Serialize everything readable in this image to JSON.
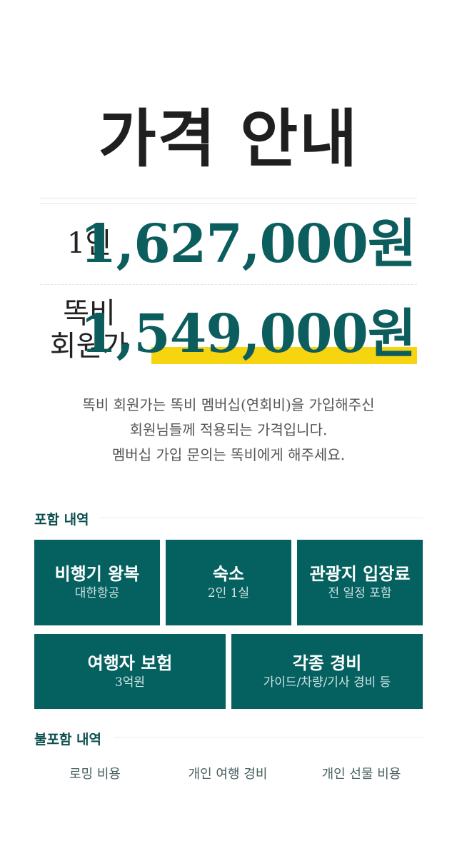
{
  "title": "가격 안내",
  "prices": [
    {
      "label_line1": "1인",
      "label_line2": "",
      "amount": "1,627,000원"
    },
    {
      "label_line1": "똑비",
      "label_line2": "회원가",
      "amount": "1,549,000원"
    }
  ],
  "note": [
    "똑비 회원가는 똑비 멤버십(연회비)을 가입해주신",
    "회원님들께 적용되는 가격입니다.",
    "멤버십 가입 문의는 똑비에게 해주세요."
  ],
  "included": {
    "heading": "포함 내역",
    "items": [
      {
        "title": "비행기 왕복",
        "sub": "대한항공"
      },
      {
        "title": "숙소",
        "sub": "2인 1실"
      },
      {
        "title": "관광지 입장료",
        "sub": "전 일정 포함"
      },
      {
        "title": "여행자 보험",
        "sub": "3억원"
      },
      {
        "title": "각종 경비",
        "sub": "가이드/차량/기사 경비 등"
      }
    ]
  },
  "excluded": {
    "heading": "불포함 내역",
    "items": [
      "로밍 비용",
      "개인 여행 경비",
      "개인 선물 비용"
    ]
  },
  "colors": {
    "accent": "#056060",
    "price": "#0c5d5d",
    "highlight": "#f6d410"
  }
}
